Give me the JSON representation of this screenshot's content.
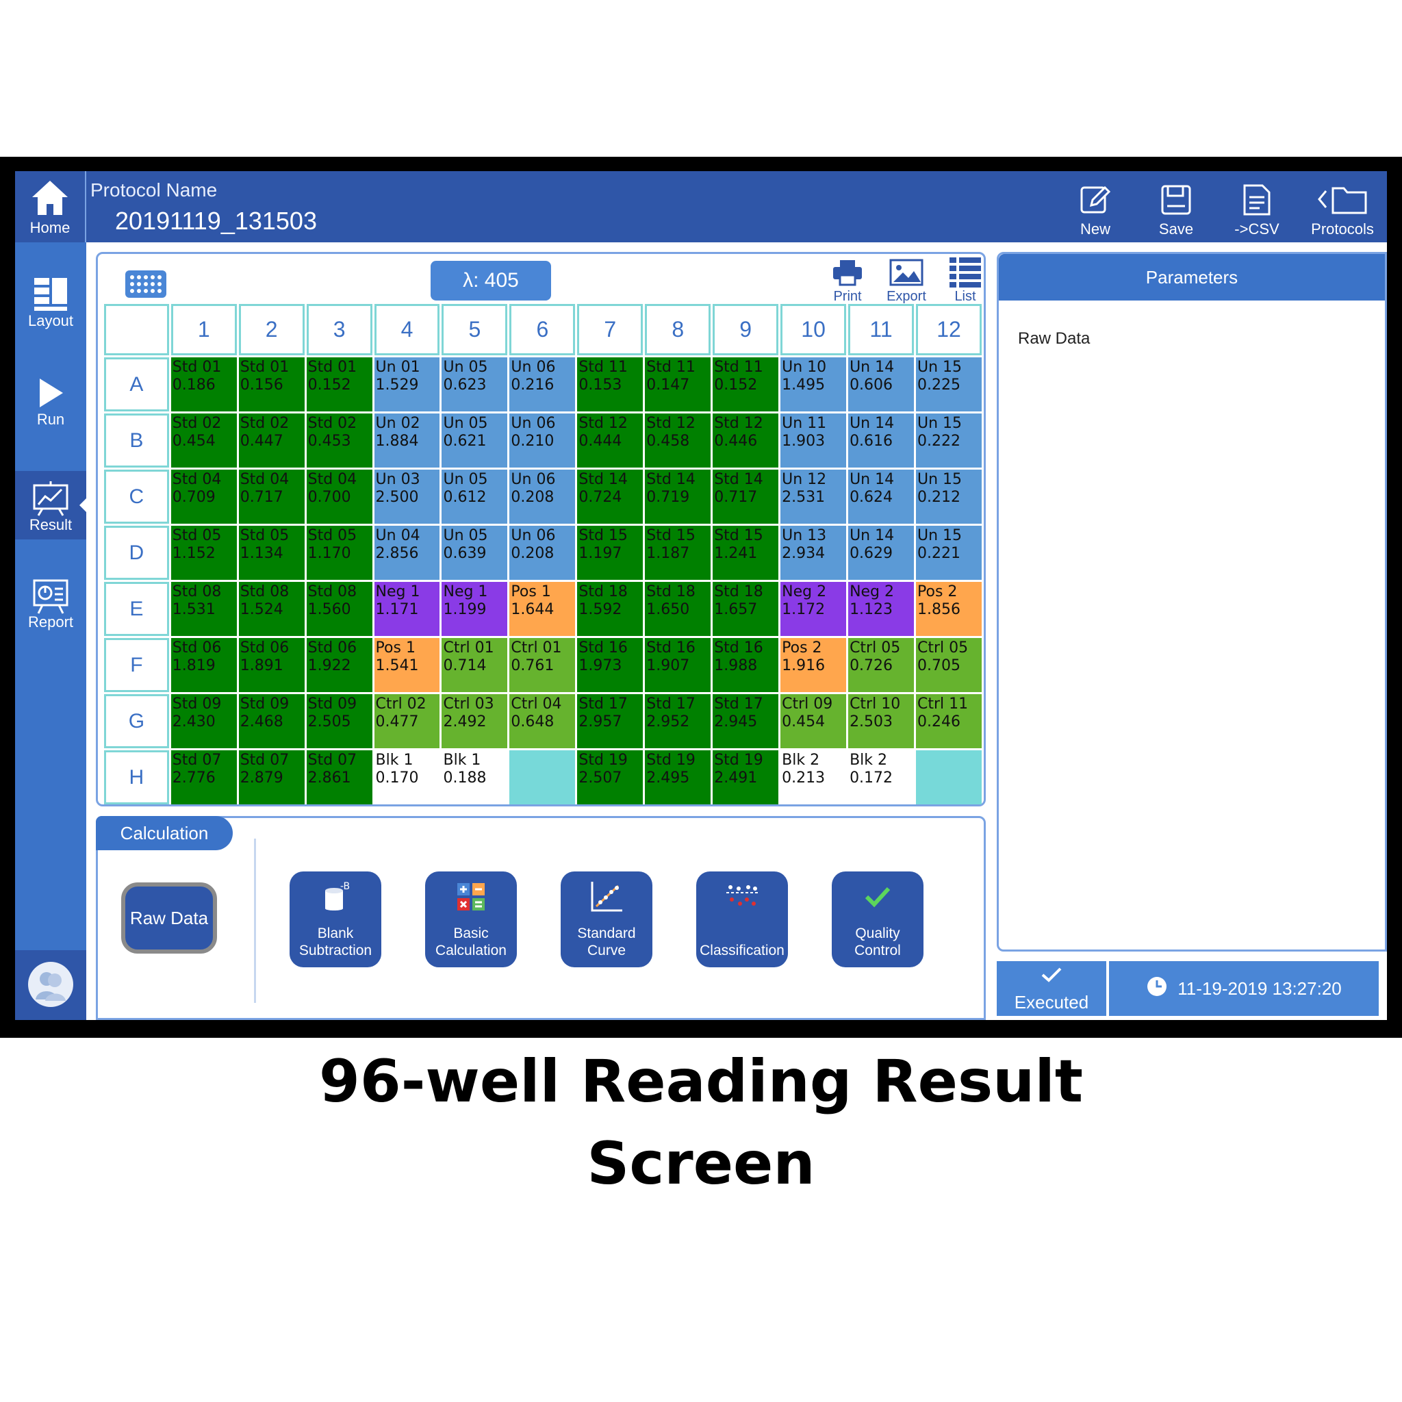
{
  "protocol": {
    "label": "Protocol Name",
    "name": "20191119_131503"
  },
  "sidebar": {
    "home": "Home",
    "items": [
      {
        "label": "Layout",
        "icon": "layout-icon"
      },
      {
        "label": "Run",
        "icon": "play-icon"
      },
      {
        "label": "Result",
        "icon": "chart-icon",
        "active": true
      },
      {
        "label": "Report",
        "icon": "report-icon"
      }
    ]
  },
  "toolbar": {
    "new": "New",
    "save": "Save",
    "csv": "->CSV",
    "protocols": "Protocols"
  },
  "plate_tools": {
    "wavelength": "λ: 405",
    "print": "Print",
    "export": "Export",
    "list": "List"
  },
  "plate": {
    "columns": [
      "1",
      "2",
      "3",
      "4",
      "5",
      "6",
      "7",
      "8",
      "9",
      "10",
      "11",
      "12"
    ],
    "rows": [
      {
        "label": "A",
        "wells": [
          [
            "Std 01",
            "0.186",
            "std"
          ],
          [
            "Std 01",
            "0.156",
            "std"
          ],
          [
            "Std 01",
            "0.152",
            "std"
          ],
          [
            "Un  01",
            "1.529",
            "un"
          ],
          [
            "Un  05",
            "0.623",
            "un"
          ],
          [
            "Un  06",
            "0.216",
            "un"
          ],
          [
            "Std 11",
            "0.153",
            "std"
          ],
          [
            "Std 11",
            "0.147",
            "std"
          ],
          [
            "Std 11",
            "0.152",
            "std"
          ],
          [
            "Un  10",
            "1.495",
            "un"
          ],
          [
            "Un  14",
            "0.606",
            "un"
          ],
          [
            "Un  15",
            "0.225",
            "un"
          ]
        ]
      },
      {
        "label": "B",
        "wells": [
          [
            "Std 02",
            "0.454",
            "std"
          ],
          [
            "Std 02",
            "0.447",
            "std"
          ],
          [
            "Std 02",
            "0.453",
            "std"
          ],
          [
            "Un  02",
            "1.884",
            "un"
          ],
          [
            "Un  05",
            "0.621",
            "un"
          ],
          [
            "Un  06",
            "0.210",
            "un"
          ],
          [
            "Std 12",
            "0.444",
            "std"
          ],
          [
            "Std 12",
            "0.458",
            "std"
          ],
          [
            "Std 12",
            "0.446",
            "std"
          ],
          [
            "Un  11",
            "1.903",
            "un"
          ],
          [
            "Un  14",
            "0.616",
            "un"
          ],
          [
            "Un  15",
            "0.222",
            "un"
          ]
        ]
      },
      {
        "label": "C",
        "wells": [
          [
            "Std 04",
            "0.709",
            "std"
          ],
          [
            "Std 04",
            "0.717",
            "std"
          ],
          [
            "Std 04",
            "0.700",
            "std"
          ],
          [
            "Un  03",
            "2.500",
            "un"
          ],
          [
            "Un  05",
            "0.612",
            "un"
          ],
          [
            "Un  06",
            "0.208",
            "un"
          ],
          [
            "Std 14",
            "0.724",
            "std"
          ],
          [
            "Std 14",
            "0.719",
            "std"
          ],
          [
            "Std 14",
            "0.717",
            "std"
          ],
          [
            "Un  12",
            "2.531",
            "un"
          ],
          [
            "Un  14",
            "0.624",
            "un"
          ],
          [
            "Un  15",
            "0.212",
            "un"
          ]
        ]
      },
      {
        "label": "D",
        "wells": [
          [
            "Std 05",
            "1.152",
            "std"
          ],
          [
            "Std 05",
            "1.134",
            "std"
          ],
          [
            "Std 05",
            "1.170",
            "std"
          ],
          [
            "Un  04",
            "2.856",
            "un"
          ],
          [
            "Un  05",
            "0.639",
            "un"
          ],
          [
            "Un  06",
            "0.208",
            "un"
          ],
          [
            "Std 15",
            "1.197",
            "std"
          ],
          [
            "Std 15",
            "1.187",
            "std"
          ],
          [
            "Std 15",
            "1.241",
            "std"
          ],
          [
            "Un  13",
            "2.934",
            "un"
          ],
          [
            "Un  14",
            "0.629",
            "un"
          ],
          [
            "Un  15",
            "0.221",
            "un"
          ]
        ]
      },
      {
        "label": "E",
        "wells": [
          [
            "Std 08",
            "1.531",
            "std"
          ],
          [
            "Std 08",
            "1.524",
            "std"
          ],
          [
            "Std 08",
            "1.560",
            "std"
          ],
          [
            "Neg  1",
            "1.171",
            "neg"
          ],
          [
            "Neg  1",
            "1.199",
            "neg"
          ],
          [
            "Pos  1",
            "1.644",
            "pos"
          ],
          [
            "Std 18",
            "1.592",
            "std"
          ],
          [
            "Std 18",
            "1.650",
            "std"
          ],
          [
            "Std 18",
            "1.657",
            "std"
          ],
          [
            "Neg  2",
            "1.172",
            "neg"
          ],
          [
            "Neg  2",
            "1.123",
            "neg"
          ],
          [
            "Pos  2",
            "1.856",
            "pos"
          ]
        ]
      },
      {
        "label": "F",
        "wells": [
          [
            "Std 06",
            "1.819",
            "std"
          ],
          [
            "Std 06",
            "1.891",
            "std"
          ],
          [
            "Std 06",
            "1.922",
            "std"
          ],
          [
            "Pos  1",
            "1.541",
            "pos"
          ],
          [
            "Ctrl 01",
            "0.714",
            "ctrl"
          ],
          [
            "Ctrl 01",
            "0.761",
            "ctrl"
          ],
          [
            "Std 16",
            "1.973",
            "std"
          ],
          [
            "Std 16",
            "1.907",
            "std"
          ],
          [
            "Std 16",
            "1.988",
            "std"
          ],
          [
            "Pos  2",
            "1.916",
            "pos"
          ],
          [
            "Ctrl 05",
            "0.726",
            "ctrl"
          ],
          [
            "Ctrl 05",
            "0.705",
            "ctrl"
          ]
        ]
      },
      {
        "label": "G",
        "wells": [
          [
            "Std 09",
            "2.430",
            "std"
          ],
          [
            "Std 09",
            "2.468",
            "std"
          ],
          [
            "Std 09",
            "2.505",
            "std"
          ],
          [
            "Ctrl 02",
            "0.477",
            "ctrl"
          ],
          [
            "Ctrl 03",
            "2.492",
            "ctrl"
          ],
          [
            "Ctrl 04",
            "0.648",
            "ctrl"
          ],
          [
            "Std 17",
            "2.957",
            "std"
          ],
          [
            "Std 17",
            "2.952",
            "std"
          ],
          [
            "Std 17",
            "2.945",
            "std"
          ],
          [
            "Ctrl 09",
            "0.454",
            "ctrl"
          ],
          [
            "Ctrl 10",
            "2.503",
            "ctrl"
          ],
          [
            "Ctrl 11",
            "0.246",
            "ctrl"
          ]
        ]
      },
      {
        "label": "H",
        "wells": [
          [
            "Std 07",
            "2.776",
            "std"
          ],
          [
            "Std 07",
            "2.879",
            "std"
          ],
          [
            "Std 07",
            "2.861",
            "std"
          ],
          [
            "Blk  1",
            "0.170",
            "blk"
          ],
          [
            "Blk  1",
            "0.188",
            "blk"
          ],
          [
            "",
            "",
            "empty"
          ],
          [
            "Std 19",
            "2.507",
            "std"
          ],
          [
            "Std 19",
            "2.495",
            "std"
          ],
          [
            "Std 19",
            "2.491",
            "std"
          ],
          [
            "Blk  2",
            "0.213",
            "blk"
          ],
          [
            "Blk  2",
            "0.172",
            "blk"
          ],
          [
            "",
            "",
            "empty"
          ]
        ]
      }
    ]
  },
  "calculation": {
    "tab": "Calculation",
    "raw_data": "Raw Data",
    "buttons": [
      {
        "label": "Blank Subtraction",
        "icon": "blank-subtraction-icon"
      },
      {
        "label": "Basic Calculation",
        "icon": "calculator-icon"
      },
      {
        "label": "Standard Curve",
        "icon": "standard-curve-icon"
      },
      {
        "label": "Classification",
        "icon": "classification-icon"
      },
      {
        "label": "Quality Control",
        "icon": "checkmark-icon"
      }
    ]
  },
  "parameters": {
    "title": "Parameters",
    "value": "Raw Data"
  },
  "status": {
    "executed": "Executed",
    "timestamp": "11-19-2019 13:27:20"
  },
  "caption": {
    "line1": "96-well Reading Result",
    "line2": "Screen"
  },
  "colors": {
    "std": "#008000",
    "un": "#5b9ad6",
    "neg": "#8a3be6",
    "pos": "#ffa64d",
    "ctrl": "#66b32e",
    "blk": "#ffffff",
    "empty": "#77d9d9",
    "accent": "#2f56a8"
  }
}
